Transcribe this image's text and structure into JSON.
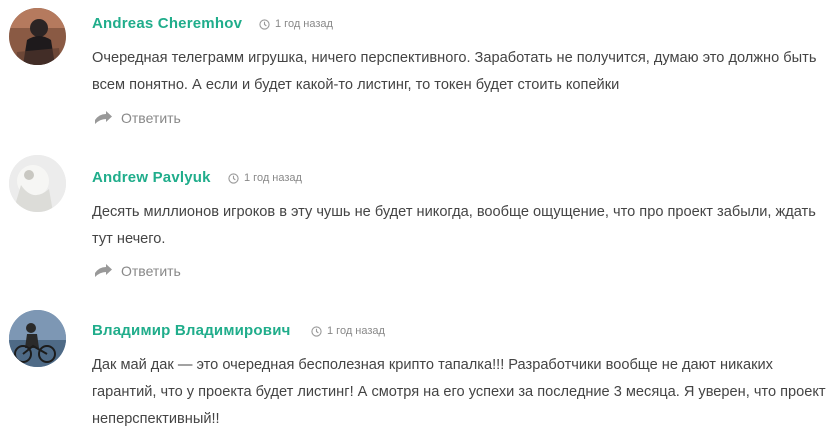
{
  "comments": [
    {
      "author": "Andreas Cheremhov",
      "time": "1 год назад",
      "text": "Очередная телеграмм игрушка, ничего перспективного. Заработать не получится, думаю это должно быть всем понятно. А если и будет какой-то листинг, то токен будет стоить копейки",
      "reply_label": "Ответить"
    },
    {
      "author": "Andrew Pavlyuk",
      "time": "1 год назад",
      "text": "Десять миллионов игроков в эту чушь не будет никогда, вообще ощущение, что про проект забыли, ждать тут нечего.",
      "reply_label": "Ответить"
    },
    {
      "author": "Владимир Владимирович",
      "time": "1 год назад",
      "text": "Дак май дак — это очередная бесполезная крипто тапалка!!! Разработчики вообще не дают никаких гарантий, что у проекта будет листинг! А смотря на его успехи за последние 3 месяца. Я уверен, что проект неперспективный!!",
      "reply_label": ""
    }
  ],
  "icons": {
    "clock": "clock-icon",
    "reply": "reply-arrow-icon"
  },
  "colors": {
    "author": "#20ad8b",
    "meta": "#888888",
    "text": "#444444"
  }
}
